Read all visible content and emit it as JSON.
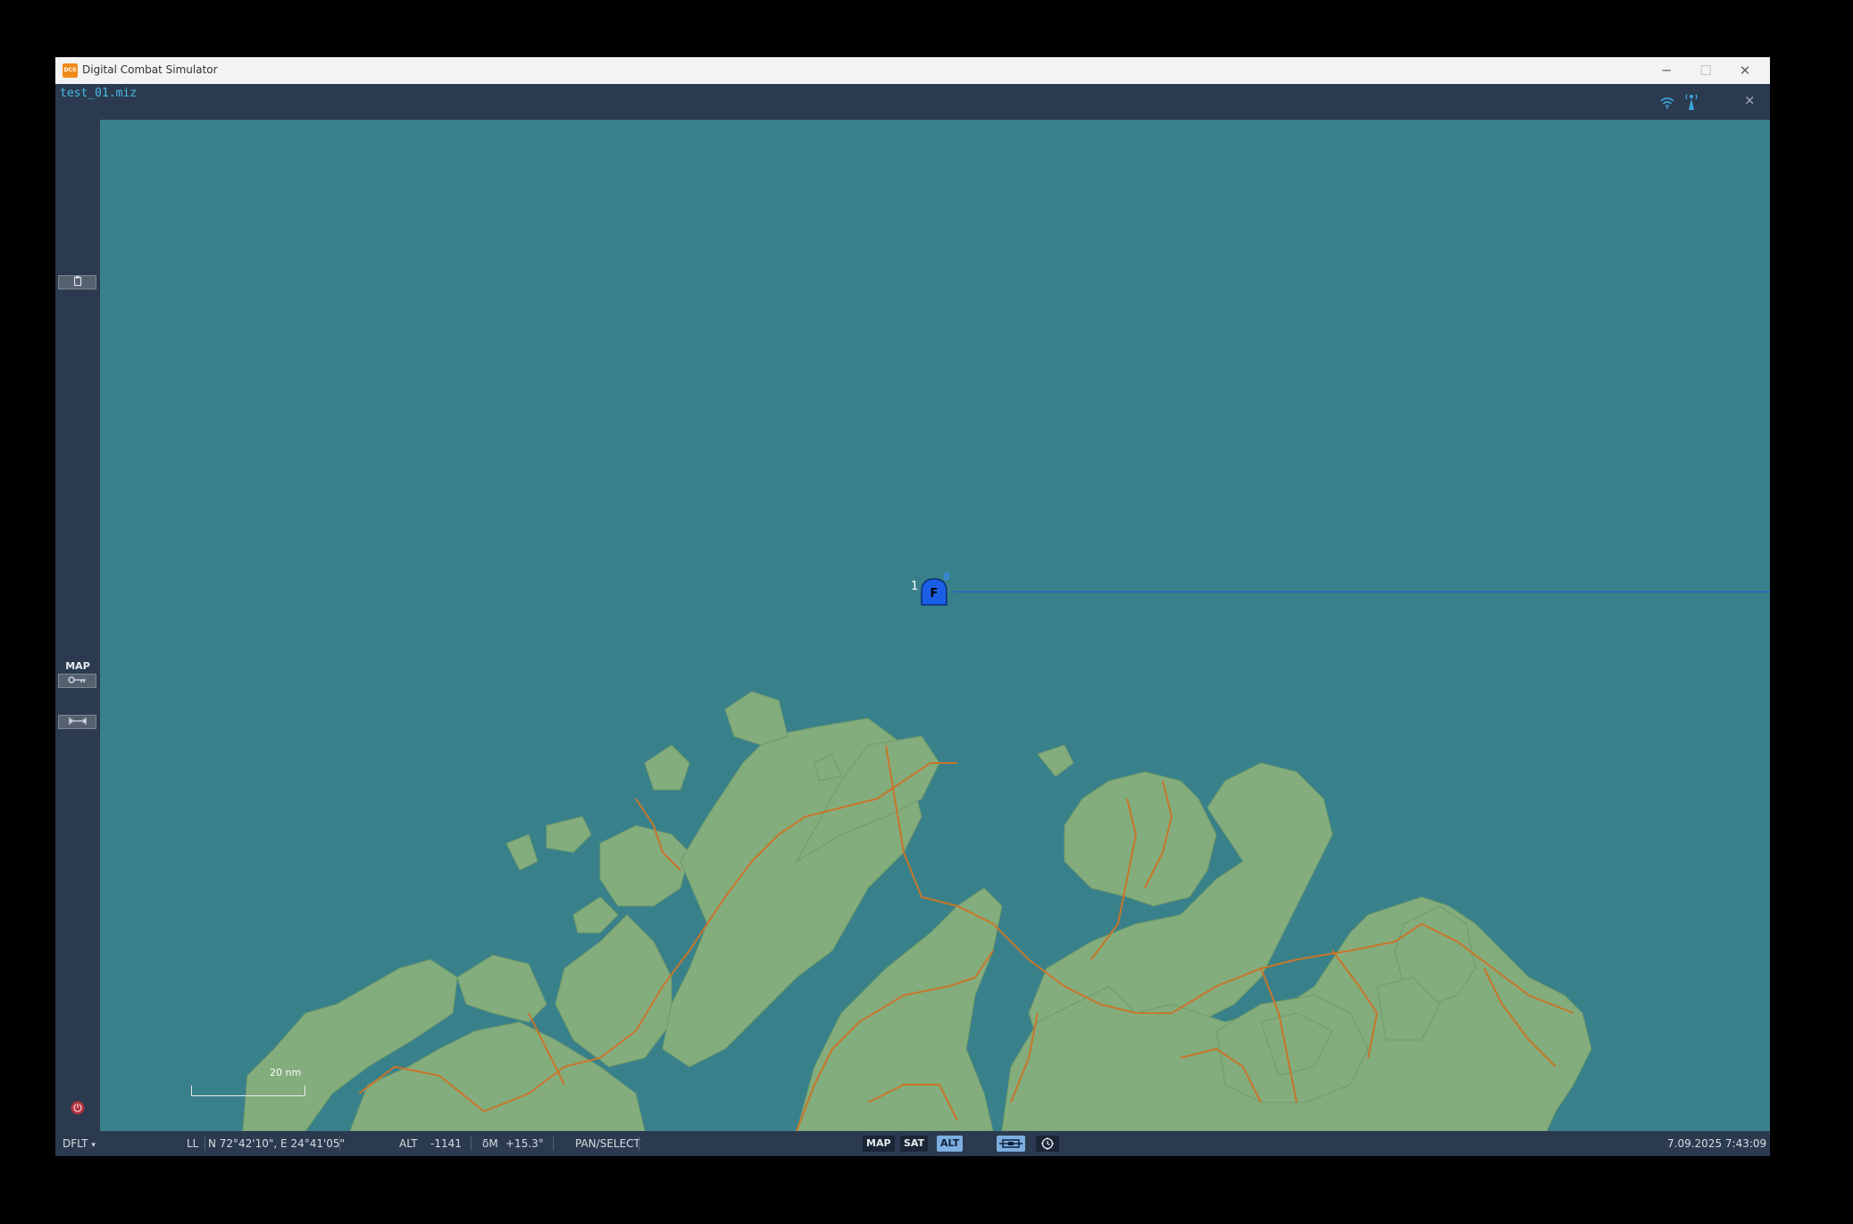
{
  "window": {
    "app_icon_text": "DCS",
    "title": "Digital Combat Simulator",
    "minimize": "─",
    "maximize": "☐",
    "close": "✕"
  },
  "header": {
    "filename": "test_01.miz",
    "close": "×",
    "icons": [
      "wifi-icon",
      "radio-tower-icon"
    ]
  },
  "left_panel": {
    "map_label": "MAP",
    "buttons": [
      "clipboard-icon",
      "map-key-icon",
      "ruler-icon"
    ],
    "bottom_icon": "exit-icon"
  },
  "map": {
    "unit": {
      "letter": "F",
      "count_label": "1",
      "heading_label": "0"
    },
    "scale": {
      "label": "20 nm"
    },
    "colors": {
      "sea": "#39818a",
      "land": "#84ad7e",
      "roads": "#c8762a",
      "unit": "#1a5fe6"
    }
  },
  "status": {
    "profile": "DFLT",
    "coord_mode": "LL",
    "coordinates": "N 72°42'10\", E 24°41'05\"",
    "alt_label": "ALT",
    "alt_value": "-1141",
    "mag_label": "δM",
    "mag_value": "+15.3°",
    "mode": "PAN/SELECT",
    "layer_buttons": [
      {
        "label": "MAP",
        "active": false
      },
      {
        "label": "SAT",
        "active": false
      },
      {
        "label": "ALT",
        "active": true
      }
    ],
    "datetime": "7.09.2025 7:43:09"
  }
}
